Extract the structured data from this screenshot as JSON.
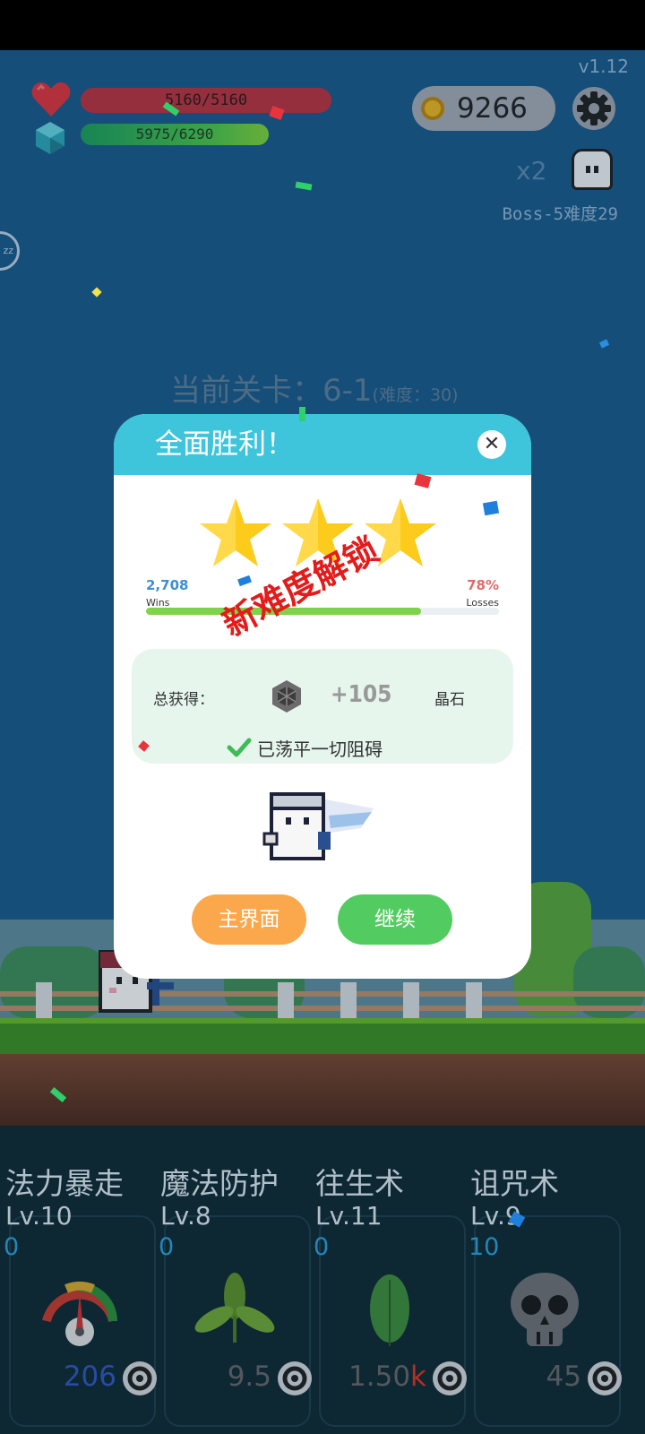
{
  "version": "v1.12",
  "hud": {
    "hp": "5160/5160",
    "mp": "5975/6290",
    "coins": "9266",
    "multiplier": "x2",
    "boss_info": "Boss-5难度29"
  },
  "level": {
    "title": "当前关卡：6-1",
    "difficulty": "(难度：30)"
  },
  "dialog": {
    "title": "全面胜利！",
    "close_symbol": "✕",
    "stars": 3,
    "wins_value": "2,708",
    "wins_label": "Wins",
    "losses_value": "78%",
    "losses_label": "Losses",
    "progress_fraction": 0.78,
    "unlock_stamp": "新难度解锁",
    "reward_label": "总获得：",
    "reward_amount": "+105",
    "reward_unit": "晶石",
    "cleared_text": "已荡平一切阻碍",
    "home_button": "主界面",
    "continue_button": "继续"
  },
  "skills": [
    {
      "name": "法力暴走",
      "level": "Lv.10",
      "count": "0",
      "cost": "206",
      "cost_unit": "",
      "icon": "gauge-icon"
    },
    {
      "name": "魔法防护",
      "level": "Lv.8",
      "count": "0",
      "cost": "9.5",
      "cost_unit": "",
      "icon": "sprout-icon"
    },
    {
      "name": "往生术",
      "level": "Lv.11",
      "count": "0",
      "cost": "1.50",
      "cost_unit": "k",
      "icon": "leaf-icon"
    },
    {
      "name": "诅咒术",
      "level": "Lv.9",
      "count": "10",
      "cost": "45",
      "cost_unit": "",
      "icon": "skull-icon"
    }
  ],
  "colors": {
    "sky": "#1a5a88",
    "dialog_header": "#3ec5dc",
    "hp": "#b7343f",
    "home_button": "#fba74c",
    "continue_button": "#52cc61",
    "stamp": "#e41b1b"
  }
}
